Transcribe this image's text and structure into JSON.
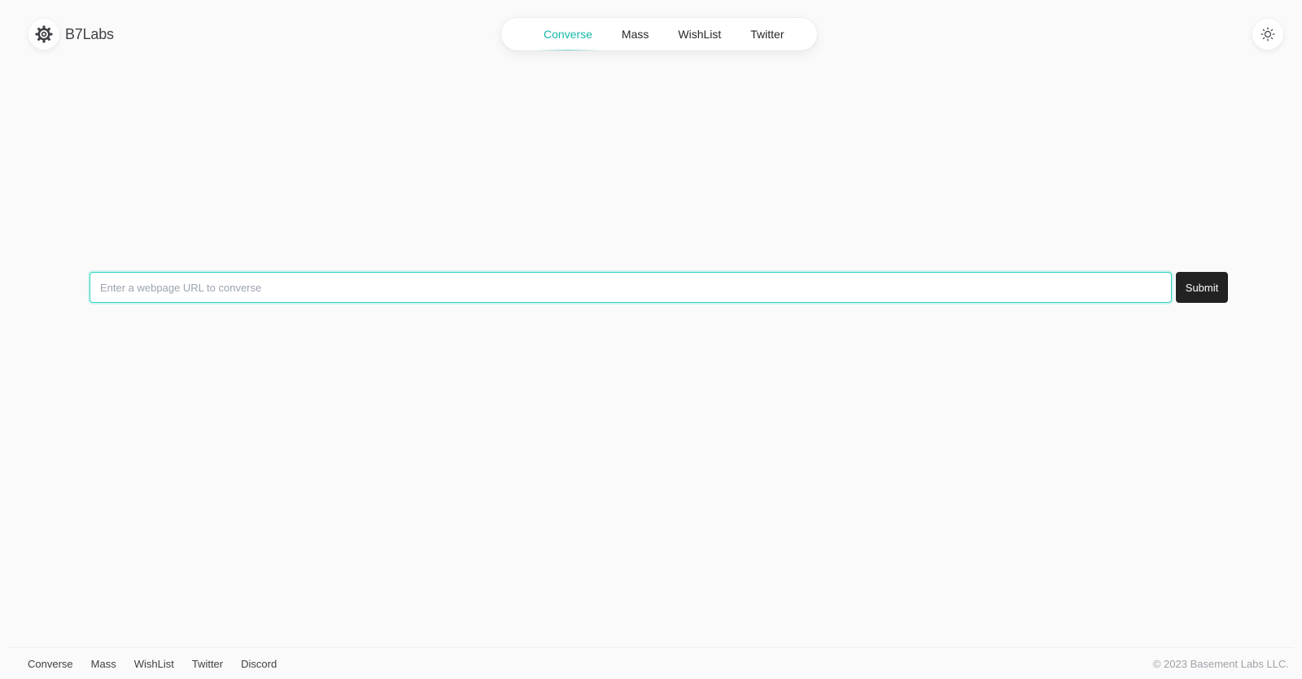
{
  "header": {
    "brand_name": "B7Labs",
    "logo_icon": "gear-cog-icon",
    "theme_toggle_icon": "sun-icon"
  },
  "nav": {
    "items": [
      {
        "label": "Converse",
        "active": true
      },
      {
        "label": "Mass",
        "active": false
      },
      {
        "label": "WishList",
        "active": false
      },
      {
        "label": "Twitter",
        "active": false
      }
    ]
  },
  "form": {
    "url_placeholder": "Enter a webpage URL to converse",
    "url_value": "",
    "submit_label": "Submit"
  },
  "footer": {
    "links": [
      "Converse",
      "Mass",
      "WishList",
      "Twitter",
      "Discord"
    ],
    "copyright": "© 2023 Basement Labs LLC."
  },
  "colors": {
    "accent": "#14b8a6",
    "background": "#fafafa",
    "button": "#222222"
  }
}
